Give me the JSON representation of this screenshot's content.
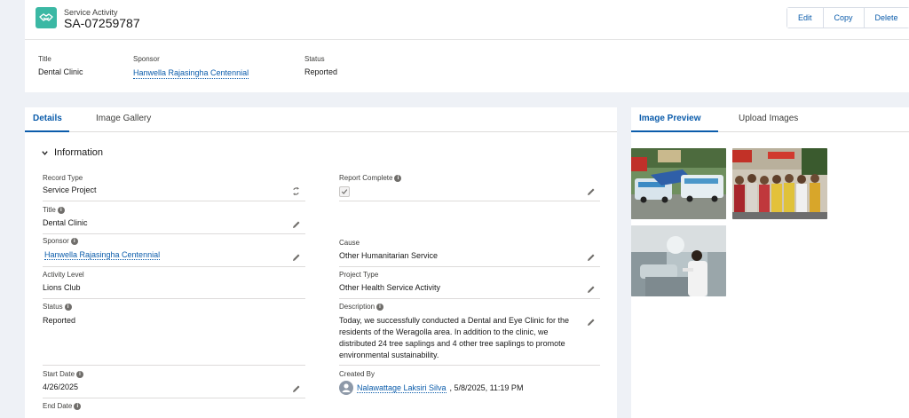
{
  "header": {
    "object_type": "Service Activity",
    "record_name": "SA-07259787",
    "buttons": [
      "Edit",
      "Copy",
      "Delete"
    ]
  },
  "highlights": {
    "title_label": "Title",
    "title_value": "Dental Clinic",
    "sponsor_label": "Sponsor",
    "sponsor_value": "Hanwella Rajasingha Centennial",
    "status_label": "Status",
    "status_value": "Reported"
  },
  "details_tabs": [
    "Details",
    "Image Gallery"
  ],
  "section_title": "Information",
  "fields": {
    "record_type": {
      "label": "Record Type",
      "value": "Service Project"
    },
    "report_complete": {
      "label": "Report Complete",
      "checked": true
    },
    "title": {
      "label": "Title",
      "value": "Dental Clinic"
    },
    "sponsor": {
      "label": "Sponsor",
      "value": "Hanwella Rajasingha Centennial"
    },
    "cause": {
      "label": "Cause",
      "value": "Other Humanitarian Service"
    },
    "activity_level": {
      "label": "Activity Level",
      "value": "Lions Club"
    },
    "project_type": {
      "label": "Project Type",
      "value": "Other Health Service Activity"
    },
    "status": {
      "label": "Status",
      "value": "Reported"
    },
    "description": {
      "label": "Description",
      "value": "Today, we successfully conducted a Dental and Eye Clinic for the residents of the Weragolla area. In addition to the clinic, we distributed 24 tree saplings and 4 other tree saplings to promote environmental sustainability."
    },
    "start_date": {
      "label": "Start Date",
      "value": "4/26/2025"
    },
    "created_by": {
      "label": "Created By",
      "user": "Nalawattage Laksiri Silva",
      "datetime": ", 5/8/2025, 11:19 PM"
    },
    "end_date": {
      "label": "End Date"
    }
  },
  "image_tabs": [
    "Image Preview",
    "Upload Images"
  ],
  "colors": {
    "brand": "#0b5cab",
    "app_icon": "#3bb8a4"
  }
}
